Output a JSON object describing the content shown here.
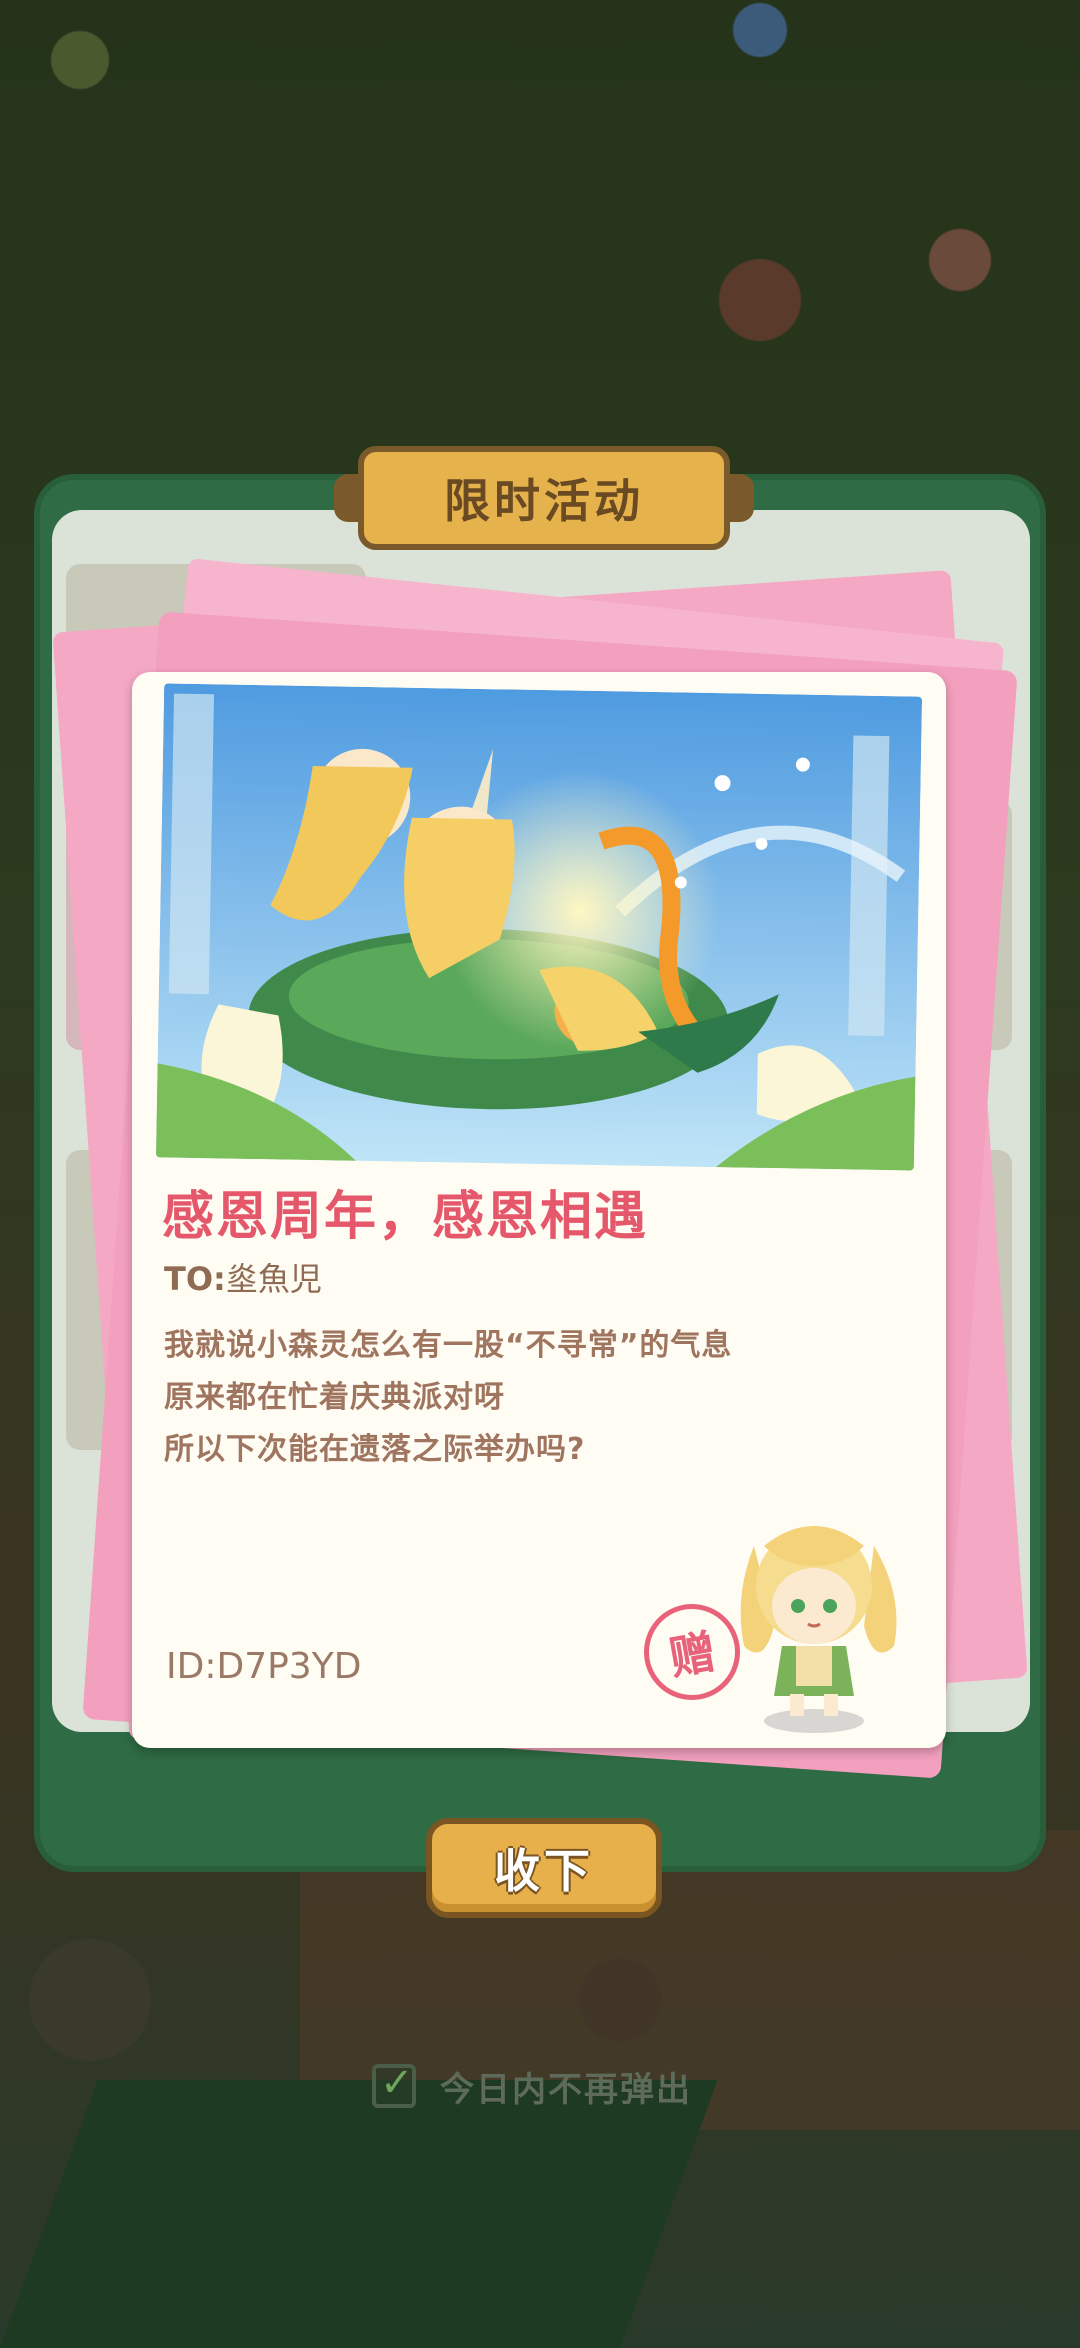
{
  "popup": {
    "title": "限时活动"
  },
  "letter": {
    "heading": "感恩周年，感恩相遇",
    "to_label": "TO:",
    "to_name": "烾魚児",
    "body_lines": [
      "我就说小森灵怎么有一股“不寻常”的气息",
      "原来都在忙着庆典派对呀",
      "所以下次能在遗落之际举办吗?"
    ],
    "id_text": "ID:D7P3YD",
    "stamp_text": "赠"
  },
  "actions": {
    "accept_label": "收下",
    "dont_show_today_label": "今日内不再弹出",
    "dont_show_today_checked": true
  },
  "colors": {
    "panel_green": "#2f6b44",
    "title_gold": "#e6b24c",
    "envelope_pink": "#f2a0bd",
    "heading_red": "#e5576a",
    "button_gold": "#e8b04a"
  },
  "icons": {
    "checkbox": "check-icon",
    "stamp": "gift-stamp-icon",
    "illustration": "anniversary-illustration",
    "mascot": "forest-spirit-chibi"
  }
}
